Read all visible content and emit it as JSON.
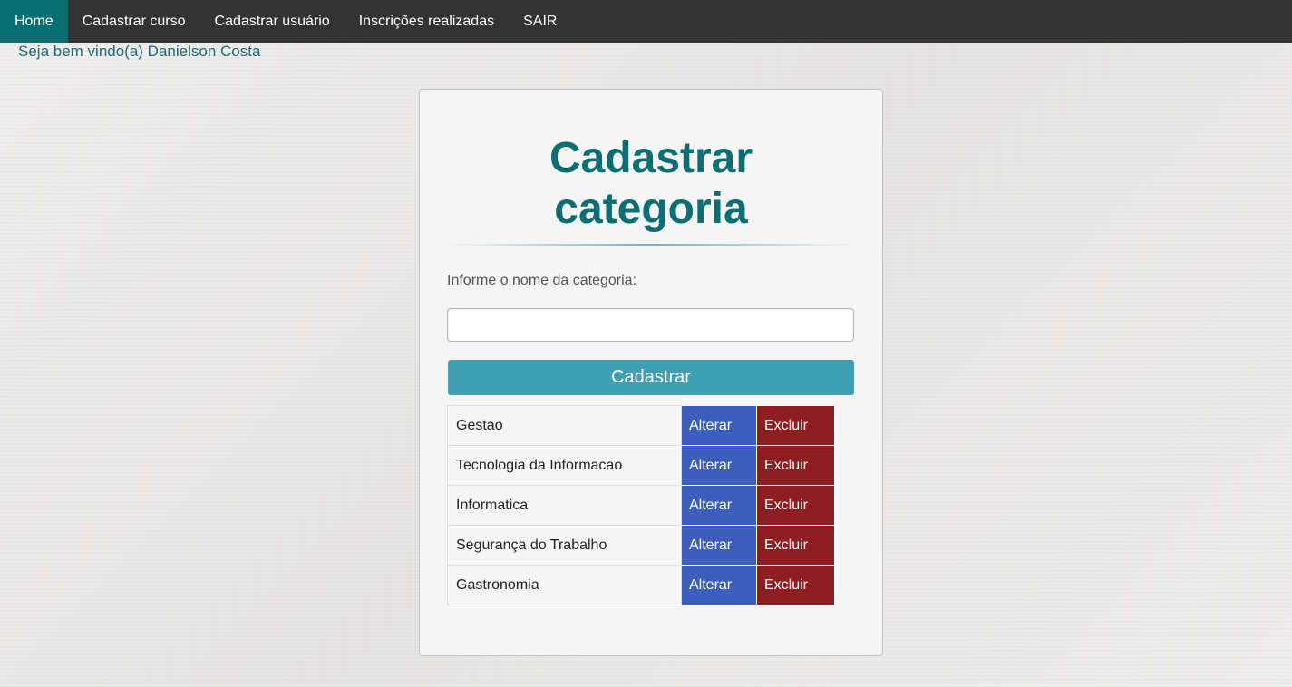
{
  "nav": {
    "items": [
      {
        "label": "Home"
      },
      {
        "label": "Cadastrar curso"
      },
      {
        "label": "Cadastrar usuário"
      },
      {
        "label": "Inscrições realizadas"
      },
      {
        "label": "SAIR"
      }
    ]
  },
  "welcome": "Seja bem vindo(a) Danielson Costa",
  "form": {
    "title_line1": "Cadastrar",
    "title_line2": "categoria",
    "field_label": "Informe o nome da categoria:",
    "input_value": "",
    "submit_label": "Cadastrar"
  },
  "categories": [
    {
      "name": "Gestao",
      "alter": "Alterar",
      "delete": "Excluir"
    },
    {
      "name": "Tecnologia da Informacao",
      "alter": "Alterar",
      "delete": "Excluir"
    },
    {
      "name": "Informatica",
      "alter": "Alterar",
      "delete": "Excluir"
    },
    {
      "name": "Segurança do Trabalho",
      "alter": "Alterar",
      "delete": "Excluir"
    },
    {
      "name": "Gastronomia",
      "alter": "Alterar",
      "delete": "Excluir"
    }
  ],
  "colors": {
    "nav_bg": "#333333",
    "nav_active": "#0b6e73",
    "title": "#0b6e73",
    "submit": "#3f9fb5",
    "alter": "#3c5ebd",
    "delete": "#8f1e22"
  }
}
